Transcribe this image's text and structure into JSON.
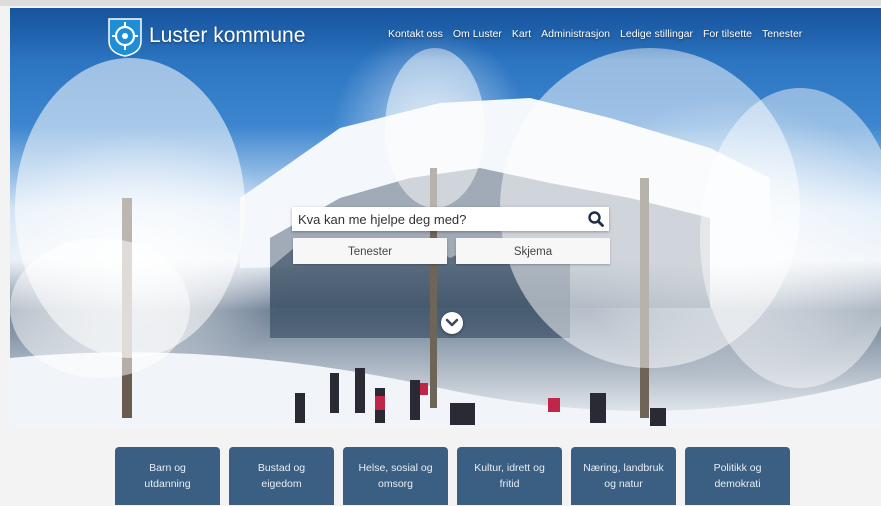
{
  "brand": {
    "name": "Luster kommune",
    "logo_icon": "luster-coat-of-arms-icon"
  },
  "nav": {
    "items": [
      "Kontakt oss",
      "Om Luster",
      "Kart",
      "Administrasjon",
      "Ledige stillingar",
      "For tilsette",
      "Tenester"
    ]
  },
  "search": {
    "placeholder": "Kva kan me hjelpe deg med?",
    "button_icon": "search-icon"
  },
  "quick_buttons": {
    "services": "Tenester",
    "forms": "Skjema"
  },
  "scroll_icon": "chevron-down-icon",
  "categories": [
    "Barn og utdanning",
    "Bustad og eigedom",
    "Helse, sosial og omsorg",
    "Kultur, idrett og fritid",
    "Næring, landbruk og natur",
    "Politikk og demokrati"
  ],
  "colors": {
    "category_bg": "#3a5f83",
    "sky": "#1e66b4",
    "logo_blue": "#1e8fd6"
  }
}
